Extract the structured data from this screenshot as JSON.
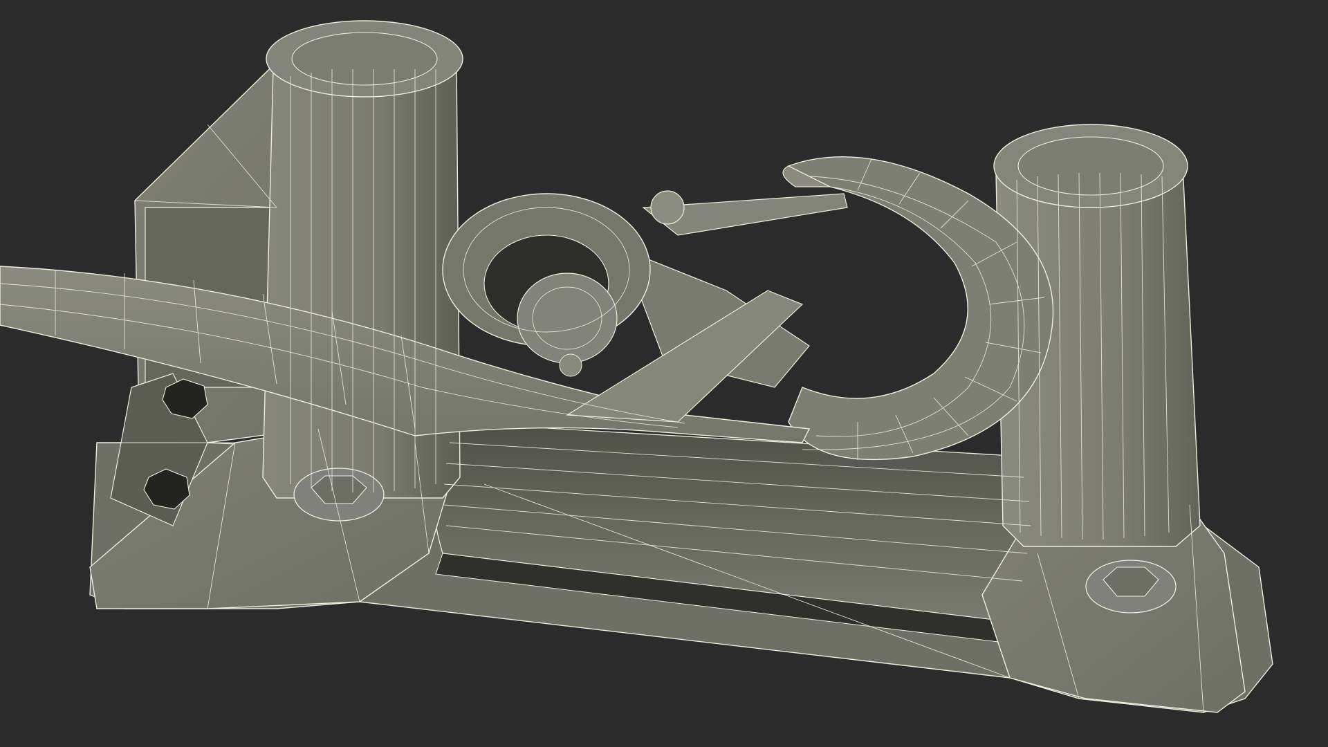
{
  "scene": {
    "subject": "wireframe-render",
    "background_color": "#2b2b2b",
    "surface_color": "#7c7d70",
    "surface_shadow_color": "#5b5c52",
    "surface_dark_color": "#4a4b43",
    "wire_color": "#eeeede"
  }
}
